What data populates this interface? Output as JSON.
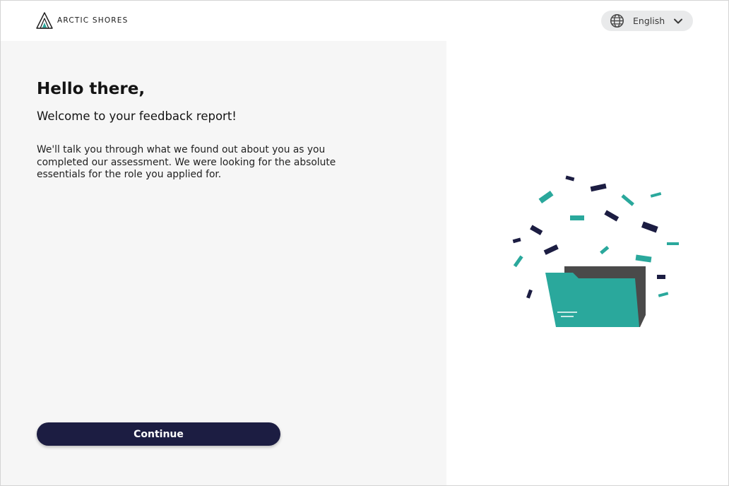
{
  "header": {
    "logo_text": "ARCTIC SHORES",
    "language": {
      "selected": "English",
      "icon": "globe-icon",
      "chevron": "chevron-down-icon"
    }
  },
  "main": {
    "greeting": "Hello there,",
    "subtitle": "Welcome to your feedback report!",
    "intro": "We'll talk you through what we found out about you as you completed our assessment. We were looking for the absolute essentials for the role you applied for.",
    "continue_label": "Continue"
  },
  "illustration": {
    "icon": "folder-confetti-illustration"
  },
  "colors": {
    "accent_teal": "#2aa89c",
    "navy": "#1c1d42",
    "panel_bg": "#f6f6f6",
    "folder_back": "#4a4a4a"
  }
}
